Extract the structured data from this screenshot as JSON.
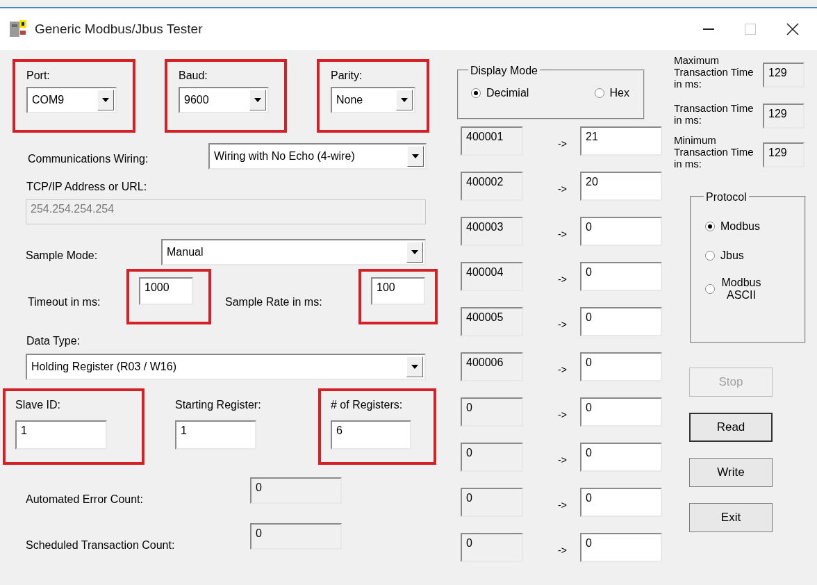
{
  "window": {
    "title": "Generic Modbus/Jbus Tester"
  },
  "serial": [
    {
      "label": "Port:",
      "value": "COM9",
      "highlighted": true
    },
    {
      "label": "Baud:",
      "value": "9600",
      "highlighted": true
    },
    {
      "label": "Parity:",
      "value": "None",
      "highlighted": true
    }
  ],
  "wiring": {
    "label": "Communications Wiring:",
    "value": "Wiring with No Echo (4-wire)"
  },
  "tcp": {
    "label": "TCP/IP Address or URL:",
    "value": "254.254.254.254",
    "disabled": true
  },
  "sample_mode": {
    "label": "Sample Mode:",
    "value": "Manual"
  },
  "timeout": {
    "label": "Timeout in ms:",
    "value": "1000",
    "highlighted": true
  },
  "sample_rate": {
    "label": "Sample Rate in ms:",
    "value": "100",
    "highlighted": true
  },
  "data_type": {
    "label": "Data Type:",
    "value": "Holding Register (R03 / W16)"
  },
  "registers": [
    {
      "label": "Slave ID:",
      "value": "1",
      "highlighted": true
    },
    {
      "label": "Starting Register:",
      "value": "1",
      "highlighted": false
    },
    {
      "label": "# of Registers:",
      "value": "6",
      "highlighted": true
    }
  ],
  "counts": [
    {
      "label": "Automated Error Count:",
      "value": "0"
    },
    {
      "label": "Scheduled Transaction Count:",
      "value": "0"
    }
  ],
  "display_mode": {
    "title": "Display Mode",
    "options": [
      {
        "label": "Decimial",
        "selected": true
      },
      {
        "label": "Hex",
        "selected": false
      }
    ]
  },
  "register_rows": [
    {
      "address": "400001",
      "arrow": "->",
      "value": "21"
    },
    {
      "address": "400002",
      "arrow": "->",
      "value": "20"
    },
    {
      "address": "400003",
      "arrow": "->",
      "value": "0"
    },
    {
      "address": "400004",
      "arrow": "->",
      "value": "0"
    },
    {
      "address": "400005",
      "arrow": "->",
      "value": "0"
    },
    {
      "address": "400006",
      "arrow": "->",
      "value": "0"
    },
    {
      "address": "0",
      "arrow": "->",
      "value": "0"
    },
    {
      "address": "0",
      "arrow": "->",
      "value": "0"
    },
    {
      "address": "0",
      "arrow": "->",
      "value": "0"
    },
    {
      "address": "0",
      "arrow": "->",
      "value": "0"
    }
  ],
  "timings": [
    {
      "label": "Maximum Transaction Time in ms:",
      "value": "129"
    },
    {
      "label": "Transaction Time in ms:",
      "value": "129"
    },
    {
      "label": "Minimum Transaction Time in ms:",
      "value": "129"
    }
  ],
  "protocol": {
    "title": "Protocol",
    "options": [
      {
        "label": "Modbus",
        "selected": true
      },
      {
        "label": "Jbus",
        "selected": false
      },
      {
        "label": "Modbus ASCII",
        "selected": false
      }
    ]
  },
  "buttons": [
    {
      "label": "Stop",
      "disabled": true,
      "default": false
    },
    {
      "label": "Read",
      "disabled": false,
      "default": true
    },
    {
      "label": "Write",
      "disabled": false,
      "default": false
    },
    {
      "label": "Exit",
      "disabled": false,
      "default": false
    }
  ]
}
